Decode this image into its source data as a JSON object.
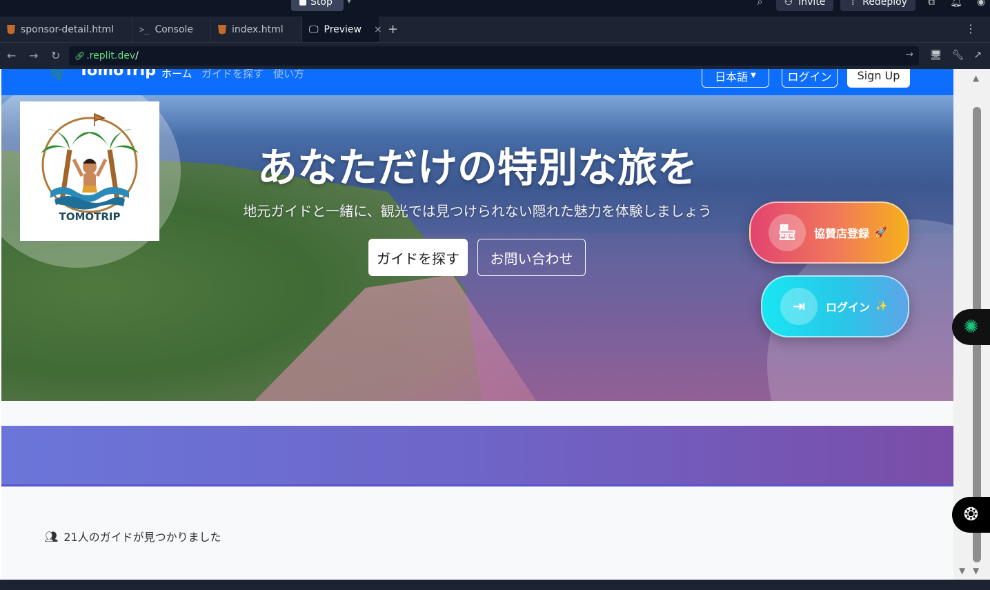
{
  "ide": {
    "stop_label": "Stop",
    "invite_label": "Invite",
    "redeploy_label": "Redeploy",
    "tabs": [
      {
        "label": "sponsor-detail.html",
        "type": "html"
      },
      {
        "label": "Console",
        "type": "console"
      },
      {
        "label": "index.html",
        "type": "html"
      },
      {
        "label": "Preview",
        "type": "preview",
        "active": true
      }
    ],
    "url": {
      "host": ".replit.dev",
      "path": "/"
    }
  },
  "site": {
    "brand": "TomoTrip",
    "nav": [
      {
        "label": "ホーム",
        "color": "#ffffff"
      },
      {
        "label": "ガイドを探す",
        "color": "#9ec5fe"
      },
      {
        "label": "使い方",
        "color": "#9ec5fe"
      }
    ],
    "language_label": "日本語",
    "login_label": "ログイン",
    "signup_label": "Sign Up"
  },
  "hero": {
    "logo_text": "TOMOTRIP",
    "title": "あなただけの特別な旅を",
    "subtitle": "地元ガイドと一緒に、観光では見つけられない隠れた魅力を体験しましょう",
    "find_button": "ガイドを探す",
    "contact_button": "お問い合わせ"
  },
  "floating": {
    "sponsor_label": "協賛店登録",
    "sponsor_emoji": "🚀",
    "login_label": "ログイン",
    "login_emoji": "✨"
  },
  "results": {
    "count_text": "21人のガイドが見つかりました"
  },
  "colors": {
    "brand_blue": "#0d6efd",
    "band_start": "#6b76d9",
    "band_end": "#7a4da8"
  }
}
